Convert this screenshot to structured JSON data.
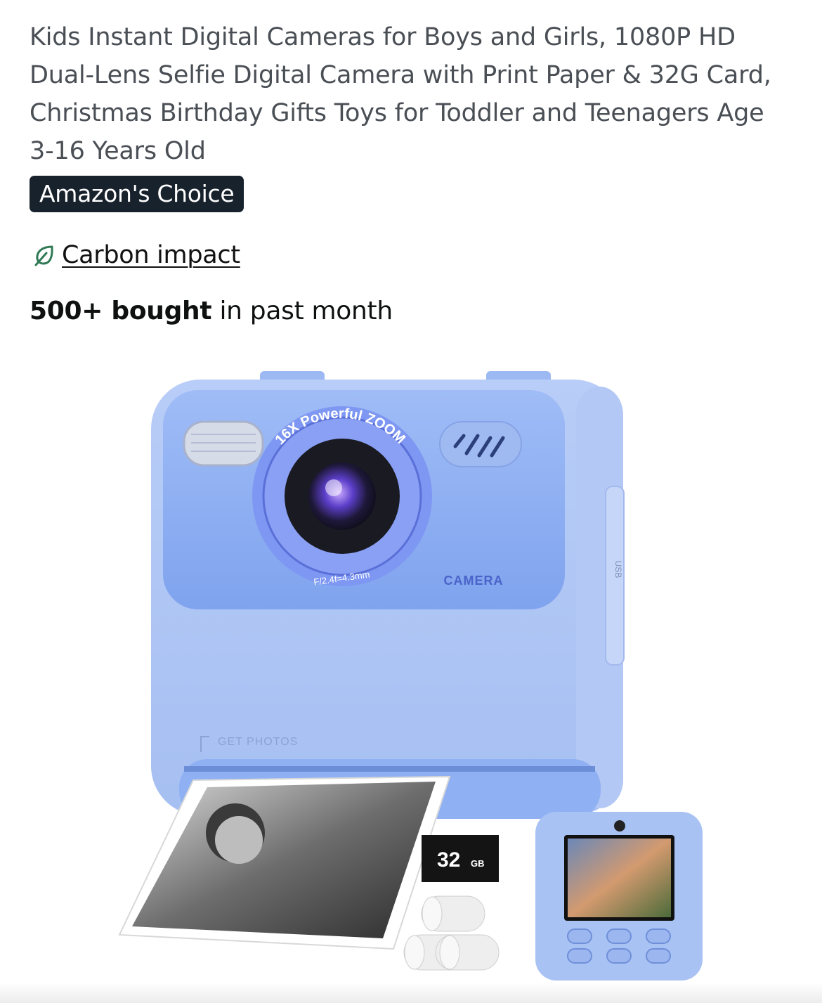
{
  "product": {
    "title": "Kids Instant Digital Cameras for Boys and Girls, 1080P HD Dual-Lens Selfie Digital Camera with Print Paper & 32G Card, Christmas Birthday Gifts Toys for Toddler and Teenagers Age 3-16 Years Old",
    "badge": "Amazon's Choice",
    "carbon_link": "Carbon impact",
    "carbon_icon": "leaf-icon",
    "bought_bold": "500+ bought",
    "bought_rest": " in past month"
  },
  "image": {
    "lens_ring_text": "16X Powerful ZOOM",
    "aperture_text": "F/2.4f=4.3mm",
    "brand_text": "CAMERA",
    "print_label": "GET PHOTOS",
    "usb_text": "USB",
    "sd_card_text": "32",
    "sd_card_unit": "GB"
  },
  "colors": {
    "badge_bg": "#17222d",
    "camera_body": "#a9c4f5",
    "camera_face": "#8fb0f2",
    "leaf": "#2f7a55"
  }
}
